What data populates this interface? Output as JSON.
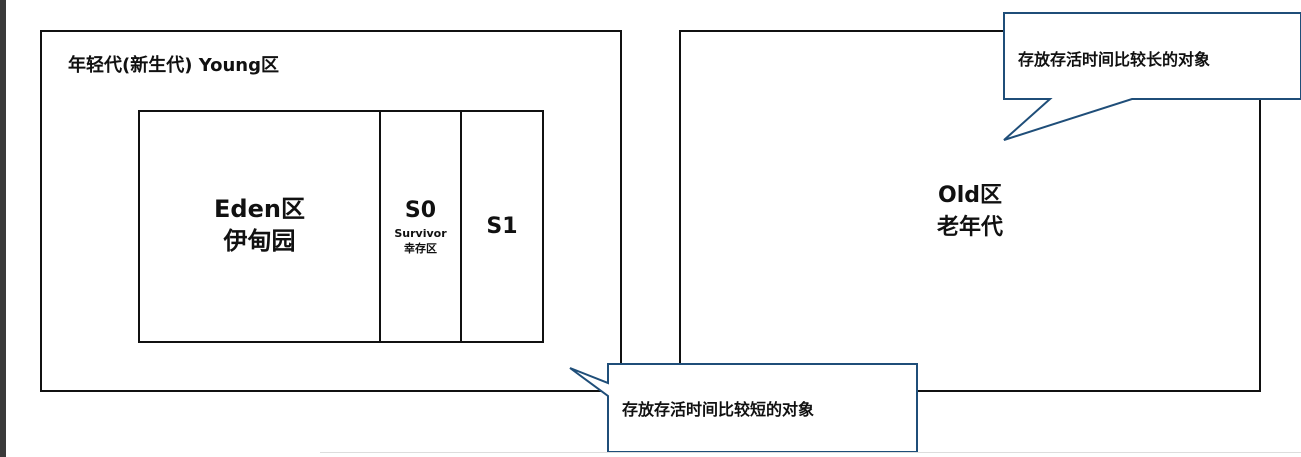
{
  "young_generation": {
    "title": "年轻代(新生代) Young区",
    "eden": {
      "name": "Eden区",
      "cn_name": "伊甸园"
    },
    "s0": {
      "name": "S0",
      "subtitle": "Survivor",
      "cn_name": "幸存区"
    },
    "s1": {
      "name": "S1"
    }
  },
  "old_generation": {
    "name": "Old区",
    "cn_name": "老年代"
  },
  "callouts": {
    "long_lived": "存放存活时间比较长的对象",
    "short_lived": "存放存活时间比较短的对象"
  },
  "colors": {
    "box_border": "#111111",
    "callout_border": "#1f4e79",
    "text": "#111111"
  }
}
